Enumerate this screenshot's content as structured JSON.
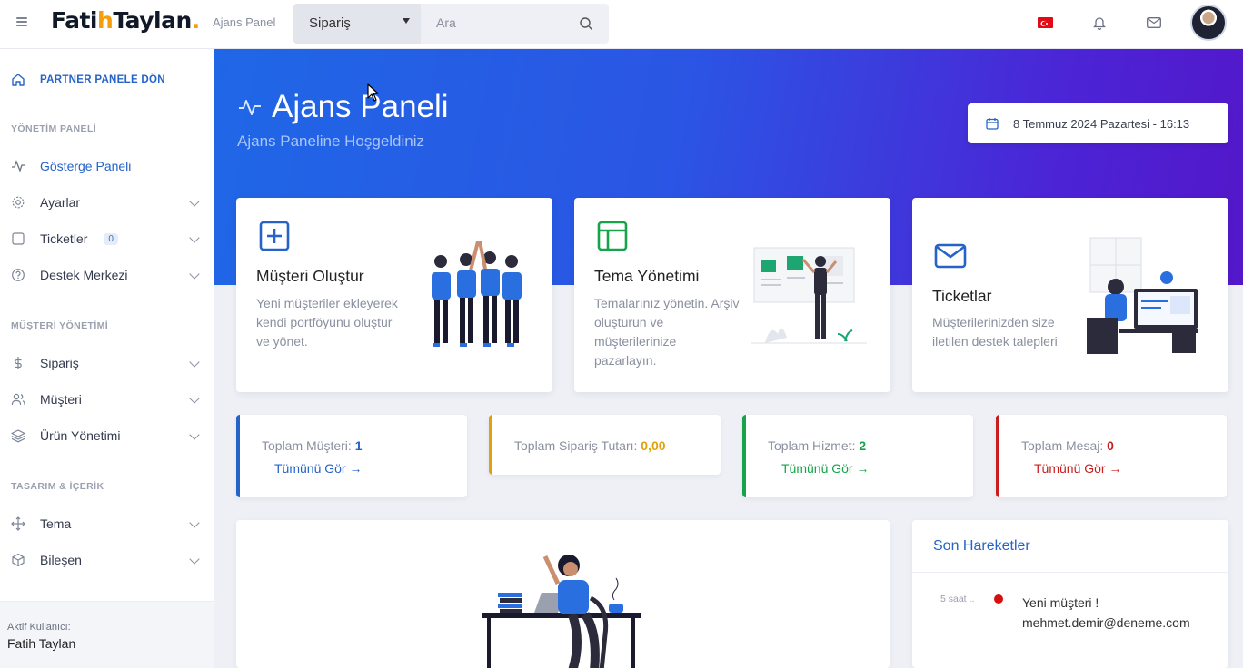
{
  "topbar": {
    "logo_part1": "Fati",
    "logo_h": "h",
    "logo_part2": "Taylan",
    "logo_dot": ".",
    "panel_label": "Ajans Panel",
    "search_category": "Sipariş",
    "search_placeholder": "Ara",
    "icons": [
      "menu-icon",
      "search-icon",
      "tr-flag-icon",
      "bell-icon",
      "mail-icon"
    ]
  },
  "sidebar": {
    "back_label": "PARTNER PANELE DÖN",
    "sections": [
      "YÖNETİM PANELİ",
      "MÜŞTERİ YÖNETİMİ",
      "TASARIM & İÇERİK"
    ],
    "items": [
      {
        "label": "Gösterge Paneli",
        "icon": "activity-icon"
      },
      {
        "label": "Ayarlar",
        "icon": "gear-icon"
      },
      {
        "label": "Ticketler",
        "icon": "square-icon",
        "badge": "0"
      },
      {
        "label": "Destek Merkezi",
        "icon": "help-circle-icon"
      },
      {
        "label": "Sipariş",
        "icon": "dollar-icon"
      },
      {
        "label": "Müşteri",
        "icon": "users-icon"
      },
      {
        "label": "Ürün Yönetimi",
        "icon": "layers-icon"
      },
      {
        "label": "Tema",
        "icon": "move-icon"
      },
      {
        "label": "Bileşen",
        "icon": "box-icon"
      }
    ],
    "footer_label": "Aktif Kullanıcı:",
    "footer_user": "Fatih Taylan"
  },
  "hero": {
    "title": "Ajans Paneli",
    "subtitle": "Ajans Paneline Hoşgeldiniz",
    "date": "8 Temmuz 2024 Pazartesi - 16:13"
  },
  "cards": [
    {
      "title": "Müşteri Oluştur",
      "desc": "Yeni müşteriler ekleyerek kendi portföyunu oluştur ve yönet.",
      "color": "#2563c9"
    },
    {
      "title": "Tema Yönetimi",
      "desc": "Temalarınız yönetin. Arşiv oluşturun ve müşterilerinize pazarlayın.",
      "color": "#16a34a"
    },
    {
      "title": "Ticketlar",
      "desc": "Müşterilerinizden size iletilen destek talepleri",
      "color": "#2563c9"
    }
  ],
  "stats": [
    {
      "label": "Toplam Müşteri:",
      "value": "1",
      "link": "Tümünü Gör →",
      "color": "#2563c9"
    },
    {
      "label": "Toplam Sipariş Tutarı:",
      "value": "0,00",
      "link": "",
      "color": "#e0a10d"
    },
    {
      "label": "Toplam Hizmet:",
      "value": "2",
      "link": "Tümünü Gör →",
      "color": "#16a34a"
    },
    {
      "label": "Toplam Mesaj:",
      "value": "0",
      "link": "Tümünü Gör →",
      "color": "#c81e1e"
    }
  ],
  "activity": {
    "title": "Son Hareketler",
    "items": [
      {
        "time": "5 saat ..",
        "line1": "Yeni müşteri !",
        "line2": "mehmet.demir@deneme.com"
      }
    ]
  }
}
